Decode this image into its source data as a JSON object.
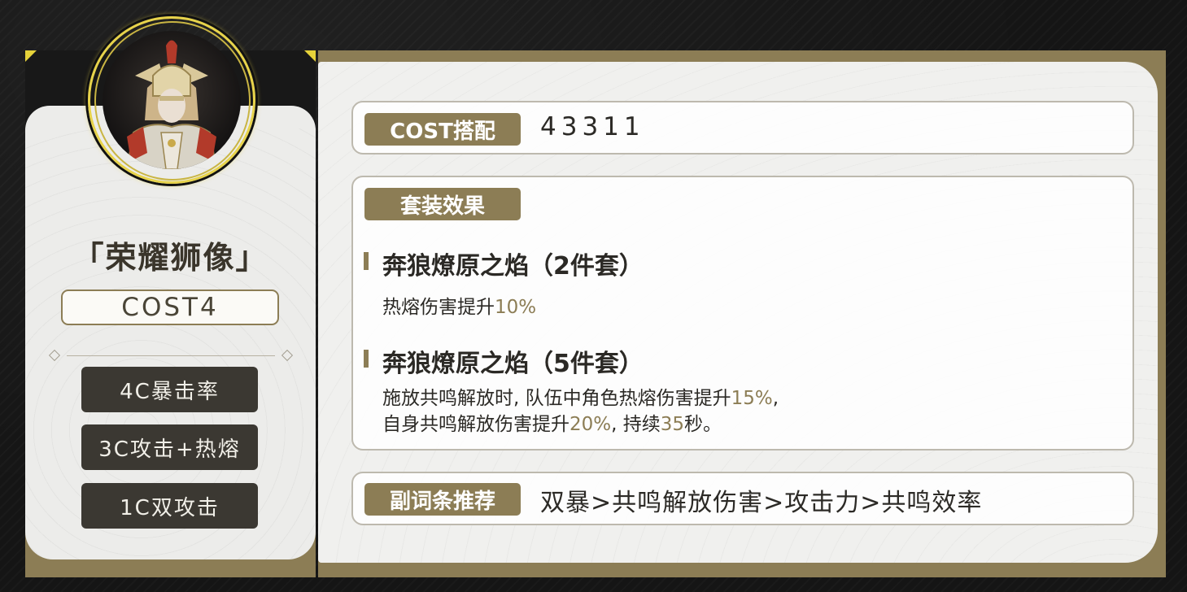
{
  "character": {
    "name": "「荣耀狮像」",
    "cost_label": "COST4",
    "main_stats": [
      "4C暴击率",
      "3C攻击+热熔",
      "1C双攻击"
    ]
  },
  "cost_combo": {
    "tag": "COST搭配",
    "value": "43311"
  },
  "set_effect": {
    "tag": "套装效果",
    "sets": [
      {
        "title": "奔狼燎原之焰（2件套）",
        "desc_prefix": "热熔伤害提升",
        "desc_value": "10%"
      },
      {
        "title": "奔狼燎原之焰（5件套）",
        "line1_prefix": "施放共鸣解放时, 队伍中角色热熔伤害提升",
        "line1_value": "15%",
        "line1_suffix": ",",
        "line2_prefix": "自身共鸣解放伤害提升",
        "line2_value": "20%",
        "line2_mid": ", 持续",
        "line2_value2": "35",
        "line2_suffix": "秒。"
      }
    ]
  },
  "substats": {
    "tag": "副词条推荐",
    "value": "双暴>共鸣解放伤害>攻击力>共鸣效率"
  },
  "colors": {
    "gold": "#8c7d55",
    "dark": "#3b3832",
    "ring": "#e7d34b"
  },
  "icons": {
    "portrait": "armored-knight-portrait"
  }
}
